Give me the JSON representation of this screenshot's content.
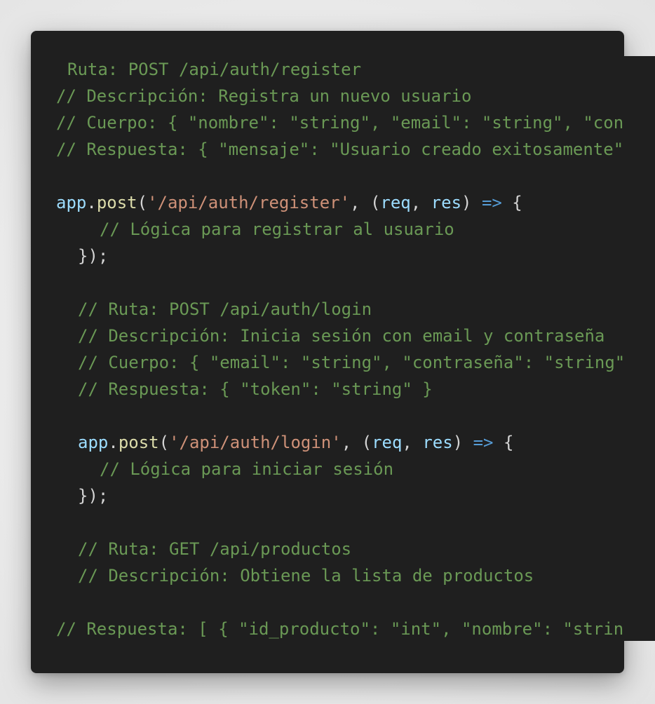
{
  "code": {
    "comment_register_route": "Ruta: POST /api/auth/register",
    "comment_register_desc": "// Descripción: Registra un nuevo usuario",
    "comment_register_body": "// Cuerpo: { \"nombre\": \"string\", \"email\": \"string\", \"con",
    "comment_register_response": "// Respuesta: { \"mensaje\": \"Usuario creado exitosamente\"",
    "register_call": {
      "object": "app",
      "dot": ".",
      "method": "post",
      "open_paren": "(",
      "path": "'/api/auth/register'",
      "sep": ", (",
      "param1": "req",
      "comma": ", ",
      "param2": "res",
      "close_paren": ") ",
      "arrow": "=>",
      "brace": " {"
    },
    "comment_register_logic": "// Lógica para registrar al usuario",
    "register_close": "});",
    "comment_login_route": "// Ruta: POST /api/auth/login",
    "comment_login_desc": "// Descripción: Inicia sesión con email y contraseña",
    "comment_login_body": "// Cuerpo: { \"email\": \"string\", \"contraseña\": \"string\"",
    "comment_login_response": "// Respuesta: { \"token\": \"string\" }",
    "login_call": {
      "object": "app",
      "dot": ".",
      "method": "post",
      "open_paren": "(",
      "path": "'/api/auth/login'",
      "sep": ", (",
      "param1": "req",
      "comma": ", ",
      "param2": "res",
      "close_paren": ") ",
      "arrow": "=>",
      "brace": " {"
    },
    "comment_login_logic": "// Lógica para iniciar sesión",
    "login_close": "});",
    "comment_products_route": "// Ruta: GET /api/productos",
    "comment_products_desc": "// Descripción: Obtiene la lista de productos",
    "comment_products_response": "// Respuesta: [ { \"id_producto\": \"int\", \"nombre\": \"strin"
  },
  "colors": {
    "background": "#1f1f1f",
    "comment": "#6a9955",
    "object": "#9cdcfe",
    "function": "#dcdcaa",
    "string": "#ce9178",
    "keyword": "#569cd6",
    "punctuation": "#d4d4d4"
  }
}
